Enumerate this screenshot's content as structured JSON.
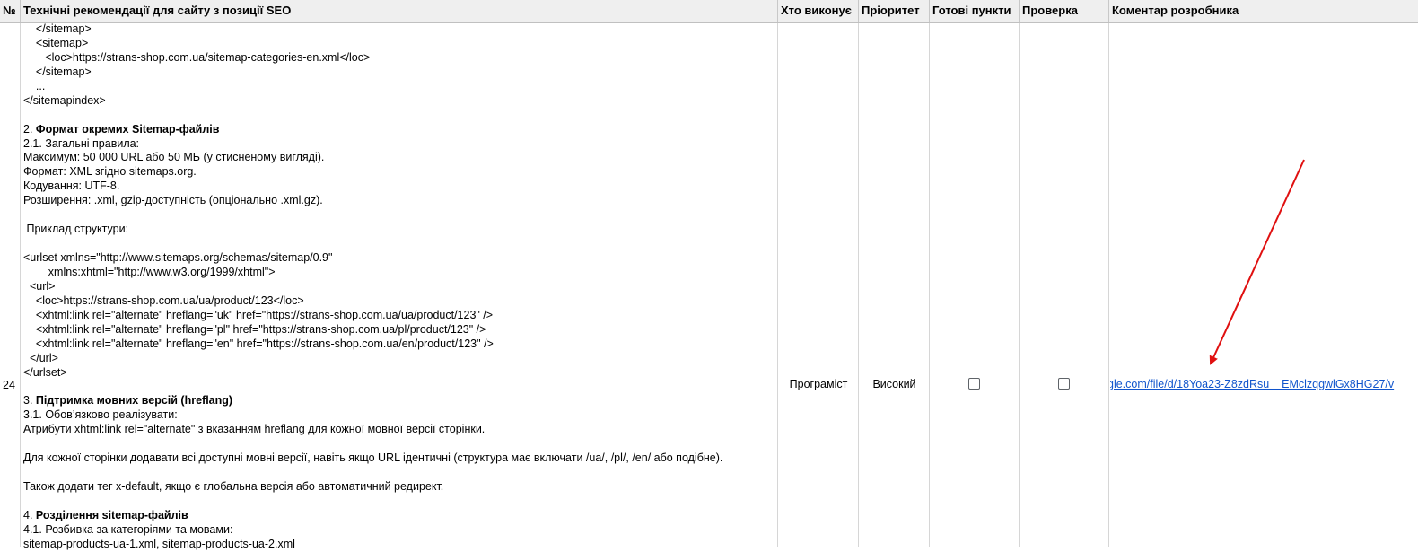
{
  "header": {
    "num": "№",
    "recommendations": "Технічні рекомендації для сайту з позиції SEO",
    "who": "Хто виконує",
    "priority": "Пріоритет",
    "ready": "Готові пункти",
    "check": "Проверка",
    "comment": "Коментар розробника"
  },
  "row": {
    "num": "24",
    "who": "Програміст",
    "priority": "Високий",
    "ready_checked": false,
    "check_checked": false,
    "comment_link": "gle.com/file/d/18Yoa23-Z8zdRsu__EMclzqgwlGx8HG27/v"
  },
  "content_lines": [
    {
      "t": "    </sitemap>"
    },
    {
      "t": "    <sitemap>"
    },
    {
      "t": "       <loc>https://strans-shop.com.ua/sitemap-categories-en.xml</loc>"
    },
    {
      "t": "    </sitemap>"
    },
    {
      "t": "    ..."
    },
    {
      "t": "</sitemapindex>"
    },
    {
      "t": ""
    },
    {
      "p": "2. ",
      "b": "Формат окремих Sitemap-файлів"
    },
    {
      "t": "2.1. Загальні правила:"
    },
    {
      "t": "Максимум: 50 000 URL або 50 МБ (у стисненому вигляді)."
    },
    {
      "t": "Формат: XML згідно sitemaps.org."
    },
    {
      "t": "Кодування: UTF-8."
    },
    {
      "t": "Розширення: .xml, gzip-доступність (опціонально .xml.gz)."
    },
    {
      "t": ""
    },
    {
      "t": " Приклад структури:"
    },
    {
      "t": ""
    },
    {
      "t": "<urlset xmlns=\"http://www.sitemaps.org/schemas/sitemap/0.9\""
    },
    {
      "t": "        xmlns:xhtml=\"http://www.w3.org/1999/xhtml\">"
    },
    {
      "t": "  <url>"
    },
    {
      "t": "    <loc>https://strans-shop.com.ua/ua/product/123</loc>"
    },
    {
      "t": "    <xhtml:link rel=\"alternate\" hreflang=\"uk\" href=\"https://strans-shop.com.ua/ua/product/123\" />"
    },
    {
      "t": "    <xhtml:link rel=\"alternate\" hreflang=\"pl\" href=\"https://strans-shop.com.ua/pl/product/123\" />"
    },
    {
      "t": "    <xhtml:link rel=\"alternate\" hreflang=\"en\" href=\"https://strans-shop.com.ua/en/product/123\" />"
    },
    {
      "t": "  </url>"
    },
    {
      "t": "</urlset>"
    },
    {
      "t": ""
    },
    {
      "p": "3. ",
      "b": "Підтримка мовних версій (hreflang)"
    },
    {
      "t": "3.1. Обов’язково реалізувати:"
    },
    {
      "t": "Атрибути xhtml:link rel=\"alternate\" з вказанням hreflang для кожної мовної версії сторінки."
    },
    {
      "t": ""
    },
    {
      "t": "Для кожної сторінки додавати всі доступні мовні версії, навіть якщо URL ідентичні (структура має включати /ua/, /pl/, /en/ або подібне)."
    },
    {
      "t": ""
    },
    {
      "t": "Також додати тег x-default, якщо є глобальна версія або автоматичний редирект."
    },
    {
      "t": ""
    },
    {
      "p": "4. ",
      "b": "Розділення sitemap-файлів"
    },
    {
      "t": "4.1. Розбивка за категоріями та мовами:"
    },
    {
      "t": "sitemap-products-ua-1.xml, sitemap-products-ua-2.xml"
    }
  ],
  "colors": {
    "header_bg": "#efefef",
    "link": "#1155cc",
    "arrow": "#e01010"
  }
}
